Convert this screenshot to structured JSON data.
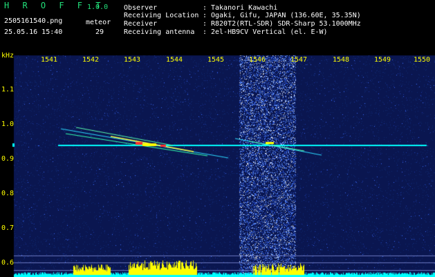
{
  "header": {
    "brand": "H R O F F T",
    "version": "1.0.0",
    "filename": "2505161540.png",
    "timestamp": "25.05.16 15:40",
    "count_label": "meteor",
    "count_value": "29",
    "info": [
      {
        "label": "Observer",
        "value": "Takanori Kawachi"
      },
      {
        "label": "Receiving Location",
        "value": "Ogaki, Gifu, JAPAN (136.60E, 35.35N)"
      },
      {
        "label": "Receiver",
        "value": "R820T2(RTL-SDR) SDR-Sharp 53.1000MHz"
      },
      {
        "label": "Receiving antenna",
        "value": "2el-HB9CV Vertical (el. E-W)"
      }
    ],
    "separator": ":"
  },
  "axes": {
    "y_unit": "kHz",
    "x_ticks": [
      "1541",
      "1542",
      "1543",
      "1544",
      "1545",
      "1546",
      "1547",
      "1548",
      "1549",
      "1550"
    ],
    "y_ticks": [
      "1.1",
      "1.0",
      "0.9",
      "0.8",
      "0.7",
      "0.6"
    ]
  },
  "colors": {
    "background": "#000000",
    "noise_bg": "#0a1650",
    "axis_text": "#ffff00",
    "brand": "#22e07a",
    "trace_cyan": "#00ffff",
    "trace_yellow": "#ffff00"
  }
}
